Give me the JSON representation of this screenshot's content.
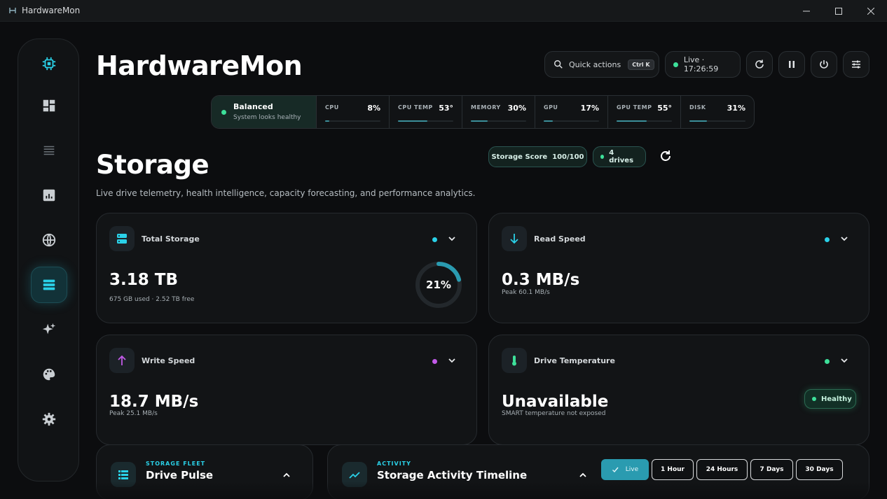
{
  "window": {
    "title": "HardwareMon"
  },
  "header": {
    "app_title": "HardwareMon",
    "quick_actions": "Quick actions",
    "shortcut": "Ctrl K",
    "live": "Live · 17:26:59"
  },
  "status": {
    "mode": "Balanced",
    "mode_sub": "System looks healthy",
    "metrics": [
      {
        "label": "CPU",
        "value": "8%",
        "level": 0.08
      },
      {
        "label": "CPU TEMP",
        "value": "53°",
        "level": 0.53
      },
      {
        "label": "MEMORY",
        "value": "30%",
        "level": 0.3
      },
      {
        "label": "GPU",
        "value": "17%",
        "level": 0.17
      },
      {
        "label": "GPU TEMP",
        "value": "55°",
        "level": 0.55
      },
      {
        "label": "DISK",
        "value": "31%",
        "level": 0.31
      }
    ]
  },
  "page": {
    "title": "Storage",
    "subtitle": "Live drive telemetry, health intelligence, capacity forecasting, and performance analytics.",
    "score": "Storage Score  100/100",
    "drives": "4 drives"
  },
  "cards": {
    "total": {
      "label": "Total Storage",
      "value": "3.18 TB",
      "sub": "675 GB used · 2.52 TB free",
      "percent_label": "21%",
      "percent": 0.21
    },
    "read": {
      "label": "Read Speed",
      "value": "0.3 MB/s",
      "sub": "Peak 60.1 MB/s"
    },
    "write": {
      "label": "Write Speed",
      "value": "18.7 MB/s",
      "sub": "Peak 25.1 MB/s"
    },
    "temp": {
      "label": "Drive Temperature",
      "value": "Unavailable",
      "sub": "SMART temperature not exposed",
      "badge": "Healthy"
    }
  },
  "bottom": {
    "fleet": {
      "kicker": "STORAGE FLEET",
      "title": "Drive Pulse"
    },
    "activity": {
      "kicker": "ACTIVITY",
      "title": "Storage Activity Timeline"
    },
    "ranges": [
      "Live",
      "1 Hour",
      "24 Hours",
      "7 Days",
      "30 Days"
    ]
  },
  "colors": {
    "accent": "#2ad1e8",
    "ok": "#3de09a",
    "write": "#c25ae8"
  }
}
